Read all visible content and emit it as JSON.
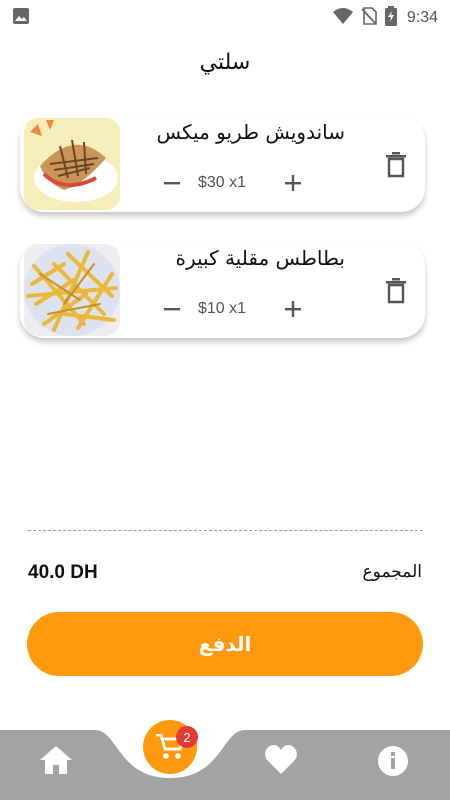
{
  "status_bar": {
    "time": "9:34",
    "icons": [
      "gallery-icon",
      "wifi-icon",
      "no-sim-icon",
      "battery-charging-icon"
    ]
  },
  "page": {
    "title": "سلتي"
  },
  "cart": {
    "items": [
      {
        "name": "ساندويش طريو ميكس",
        "price_qty": "$30 x1",
        "image": "sandwich-image"
      },
      {
        "name": "بطاطس مقلية كبيرة",
        "price_qty": "$10 x1",
        "image": "fries-image"
      }
    ]
  },
  "summary": {
    "total_label": "المجموع",
    "total_value": "40.0 DH"
  },
  "checkout": {
    "button_label": "الدفع"
  },
  "nav": {
    "cart_badge": "2",
    "icons": [
      "home-icon",
      "cart-icon",
      "heart-icon",
      "info-icon"
    ]
  },
  "colors": {
    "accent": "#FF9A0F",
    "badge": "#E53935",
    "nav_bg": "#A3A3A3",
    "text": "#111111",
    "muted": "#555555"
  }
}
